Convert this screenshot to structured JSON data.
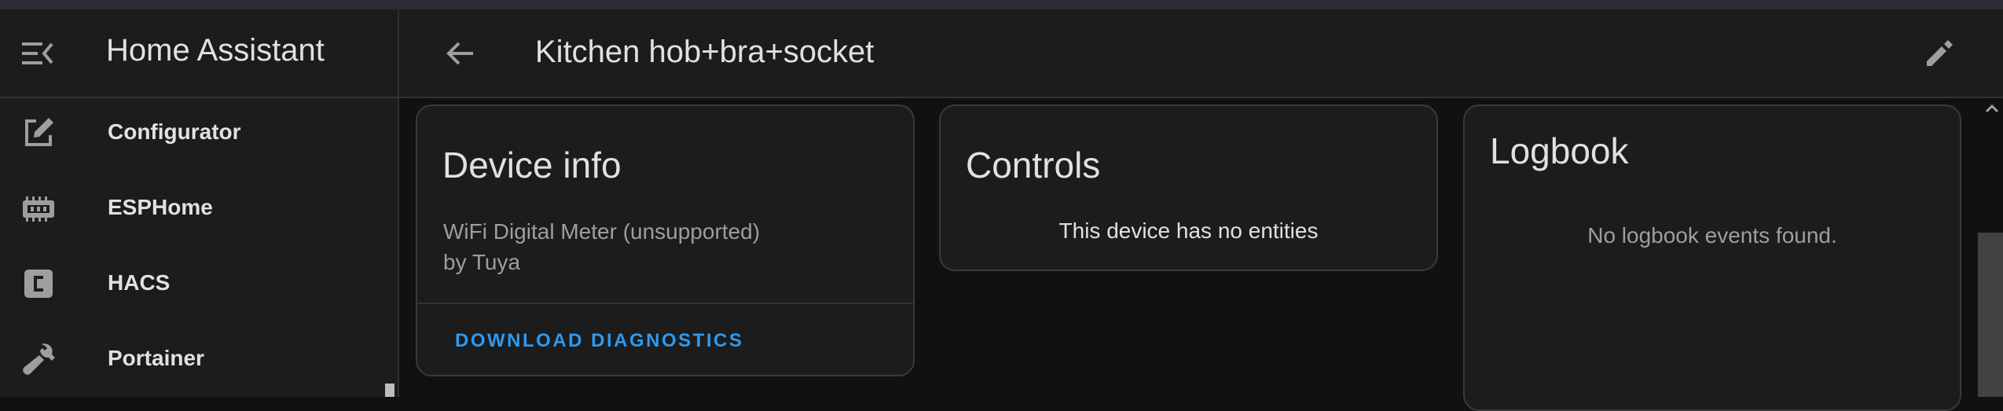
{
  "app": {
    "title": "Home Assistant"
  },
  "sidebar": {
    "items": [
      {
        "label": "Configurator",
        "icon": "file-edit-icon"
      },
      {
        "label": "ESPHome",
        "icon": "esphome-chip-icon"
      },
      {
        "label": "HACS",
        "icon": "hacs-icon"
      },
      {
        "label": "Portainer",
        "icon": "wrench-icon"
      }
    ]
  },
  "header": {
    "title": "Kitchen hob+bra+socket"
  },
  "cards": {
    "device_info": {
      "title": "Device info",
      "model": "WiFi Digital Meter (unsupported)",
      "manufacturer": "by Tuya",
      "action": "DOWNLOAD DIAGNOSTICS"
    },
    "controls": {
      "title": "Controls",
      "empty_text": "This device has no entities"
    },
    "logbook": {
      "title": "Logbook",
      "empty_text": "No logbook events found."
    }
  },
  "colors": {
    "background": "#111111",
    "surface": "#1c1c1c",
    "accent": "#2b9af3",
    "text_primary": "#e1e1e1",
    "text_secondary": "#9e9e9e"
  }
}
